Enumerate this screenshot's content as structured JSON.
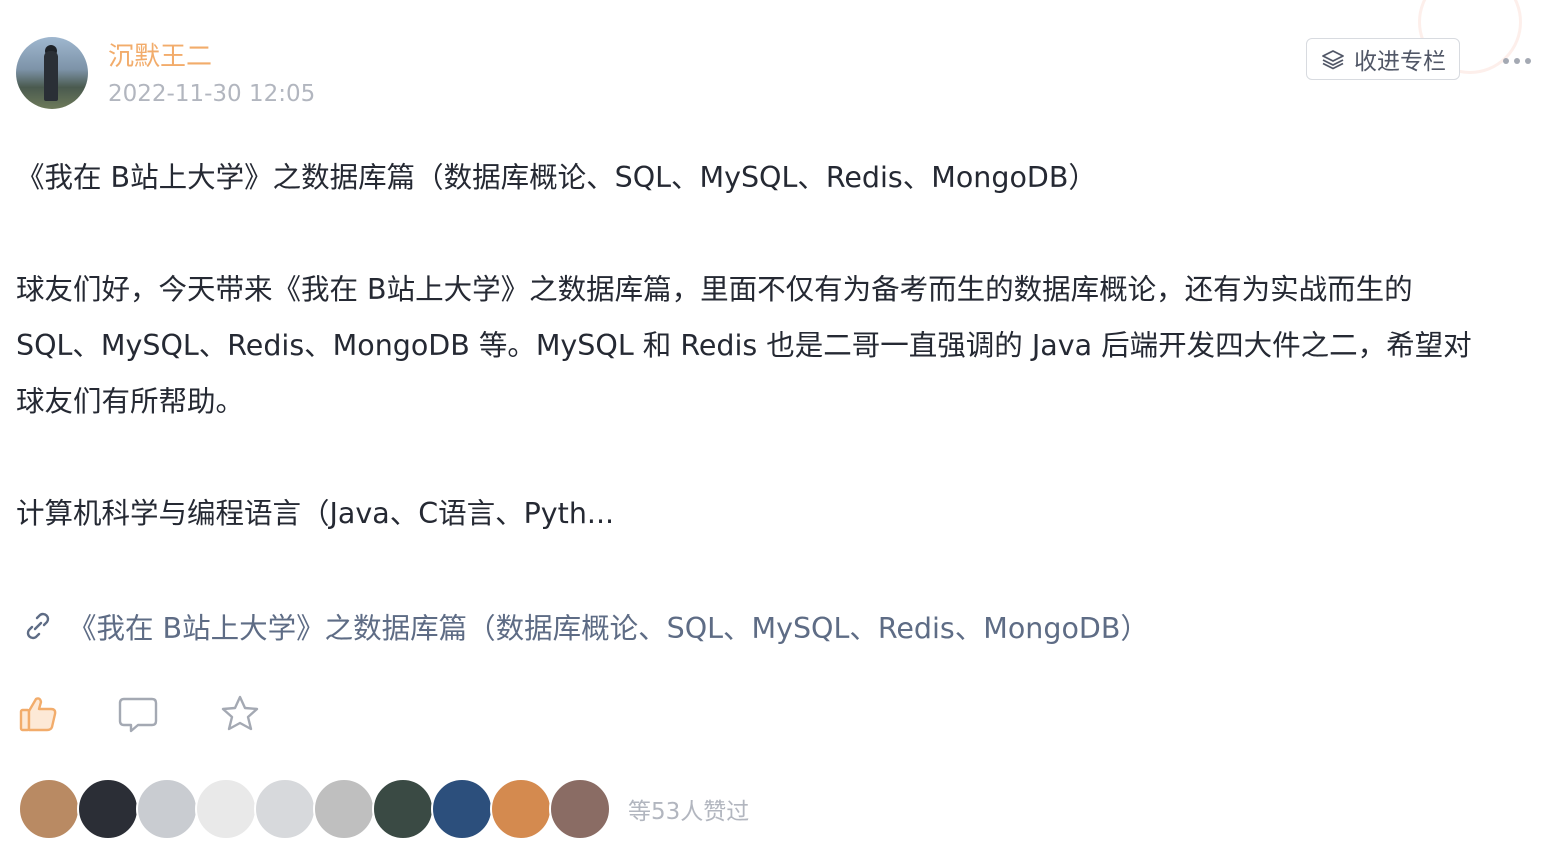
{
  "author": {
    "name": "沉默王二",
    "time": "2022-11-30 12:05"
  },
  "actions": {
    "collect_label": "收进专栏"
  },
  "post": {
    "paragraphs": [
      "《我在 B站上大学》之数据库篇（数据库概论、SQL、MySQL、Redis、MongoDB）",
      "球友们好，今天带来《我在 B站上大学》之数据库篇，里面不仅有为备考而生的数据库概论，还有为实战而生的",
      "SQL、MySQL、Redis、MongoDB 等。MySQL 和 Redis 也是二哥一直强调的 Java 后端开发四大件之二，希望对",
      "球友们有所帮助。",
      "计算机科学与编程语言（Java、C语言、Pyth..."
    ],
    "link_text": "《我在 B站上大学》之数据库篇（数据库概论、SQL、MySQL、Redis、MongoDB）"
  },
  "likes": {
    "summary": "等53人赞过",
    "avatar_colors": [
      "#b98a63",
      "#2b2e36",
      "#c9ccd1",
      "#e9e9e9",
      "#d7d9dc",
      "#bfbfbf",
      "#3a4a44",
      "#2c4f7c",
      "#d48a4f",
      "#8a6c64"
    ]
  },
  "colors": {
    "author": "#f2ac6b",
    "like_icon": "#f2ac6b",
    "link": "#5e6c85",
    "muted": "#b2b6bf"
  }
}
